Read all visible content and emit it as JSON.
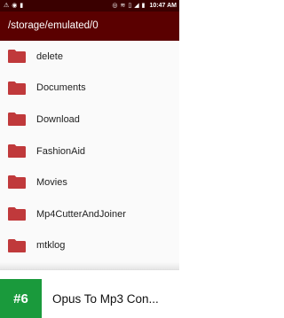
{
  "status_bar": {
    "left_icons": [
      "warning-icon",
      "location-icon",
      "sim-icon"
    ],
    "right_icons": [
      "hotspot-icon",
      "wifi-icon",
      "vibrate-icon",
      "signal-icon",
      "battery-icon"
    ],
    "time": "10:47 AM"
  },
  "app_bar": {
    "path": "/storage/emulated/0"
  },
  "folders": [
    {
      "name": "delete"
    },
    {
      "name": "Documents"
    },
    {
      "name": "Download"
    },
    {
      "name": "FashionAid"
    },
    {
      "name": "Movies"
    },
    {
      "name": "Mp4CutterAndJoiner"
    },
    {
      "name": "mtklog"
    }
  ],
  "banner": {
    "rank": "#6",
    "title": "Opus To Mp3 Con..."
  },
  "colors": {
    "status_bar": "#3a0000",
    "app_bar": "#5a0000",
    "folder": "#c0393b",
    "rank_badge": "#1a9a3c"
  }
}
